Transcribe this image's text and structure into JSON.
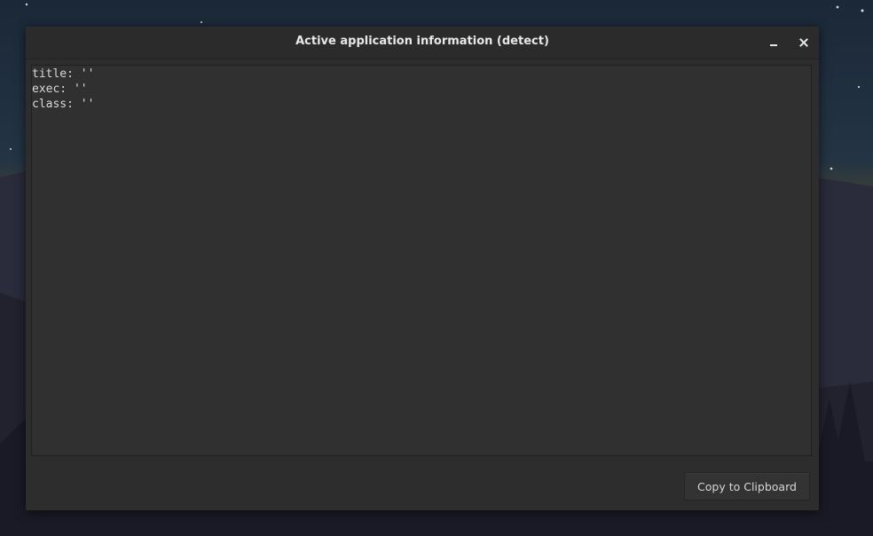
{
  "window": {
    "title": "Active application information (detect)",
    "controls": {
      "minimize_icon": "minimize-icon",
      "close_icon": "close-icon"
    }
  },
  "info": {
    "lines": [
      "title: ''",
      "exec: ''",
      "class: ''"
    ]
  },
  "actions": {
    "copy_label": "Copy to Clipboard"
  },
  "colors": {
    "window_bg": "#2d2d2d",
    "content_bg": "#303030",
    "text": "#d8d8d8",
    "title_text": "#e8e8e8"
  }
}
